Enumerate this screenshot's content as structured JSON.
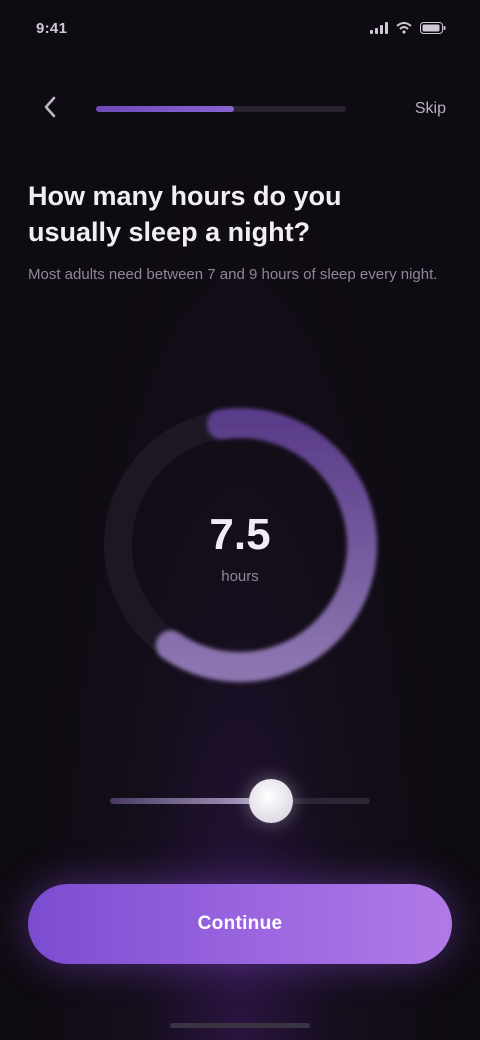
{
  "status_bar": {
    "time": "9:41",
    "icons": [
      "signal-icon",
      "wifi-icon",
      "battery-icon"
    ]
  },
  "nav": {
    "back_icon": "chevron-left-icon",
    "progress": 0.55,
    "skip_label": "Skip"
  },
  "heading": {
    "title": "How many hours do you usually sleep a night?",
    "subtitle": "Most adults need between 7 and 9 hours of sleep every night."
  },
  "ring": {
    "value": "7.5",
    "unit": "hours",
    "fraction": 0.62
  },
  "slider": {
    "level": 0.62
  },
  "cta": {
    "label": "Continue"
  },
  "colors": {
    "accent": "#8a63d2",
    "button_start": "#7c4cd0",
    "button_end": "#b07ae6",
    "background": "#0f0b12"
  }
}
